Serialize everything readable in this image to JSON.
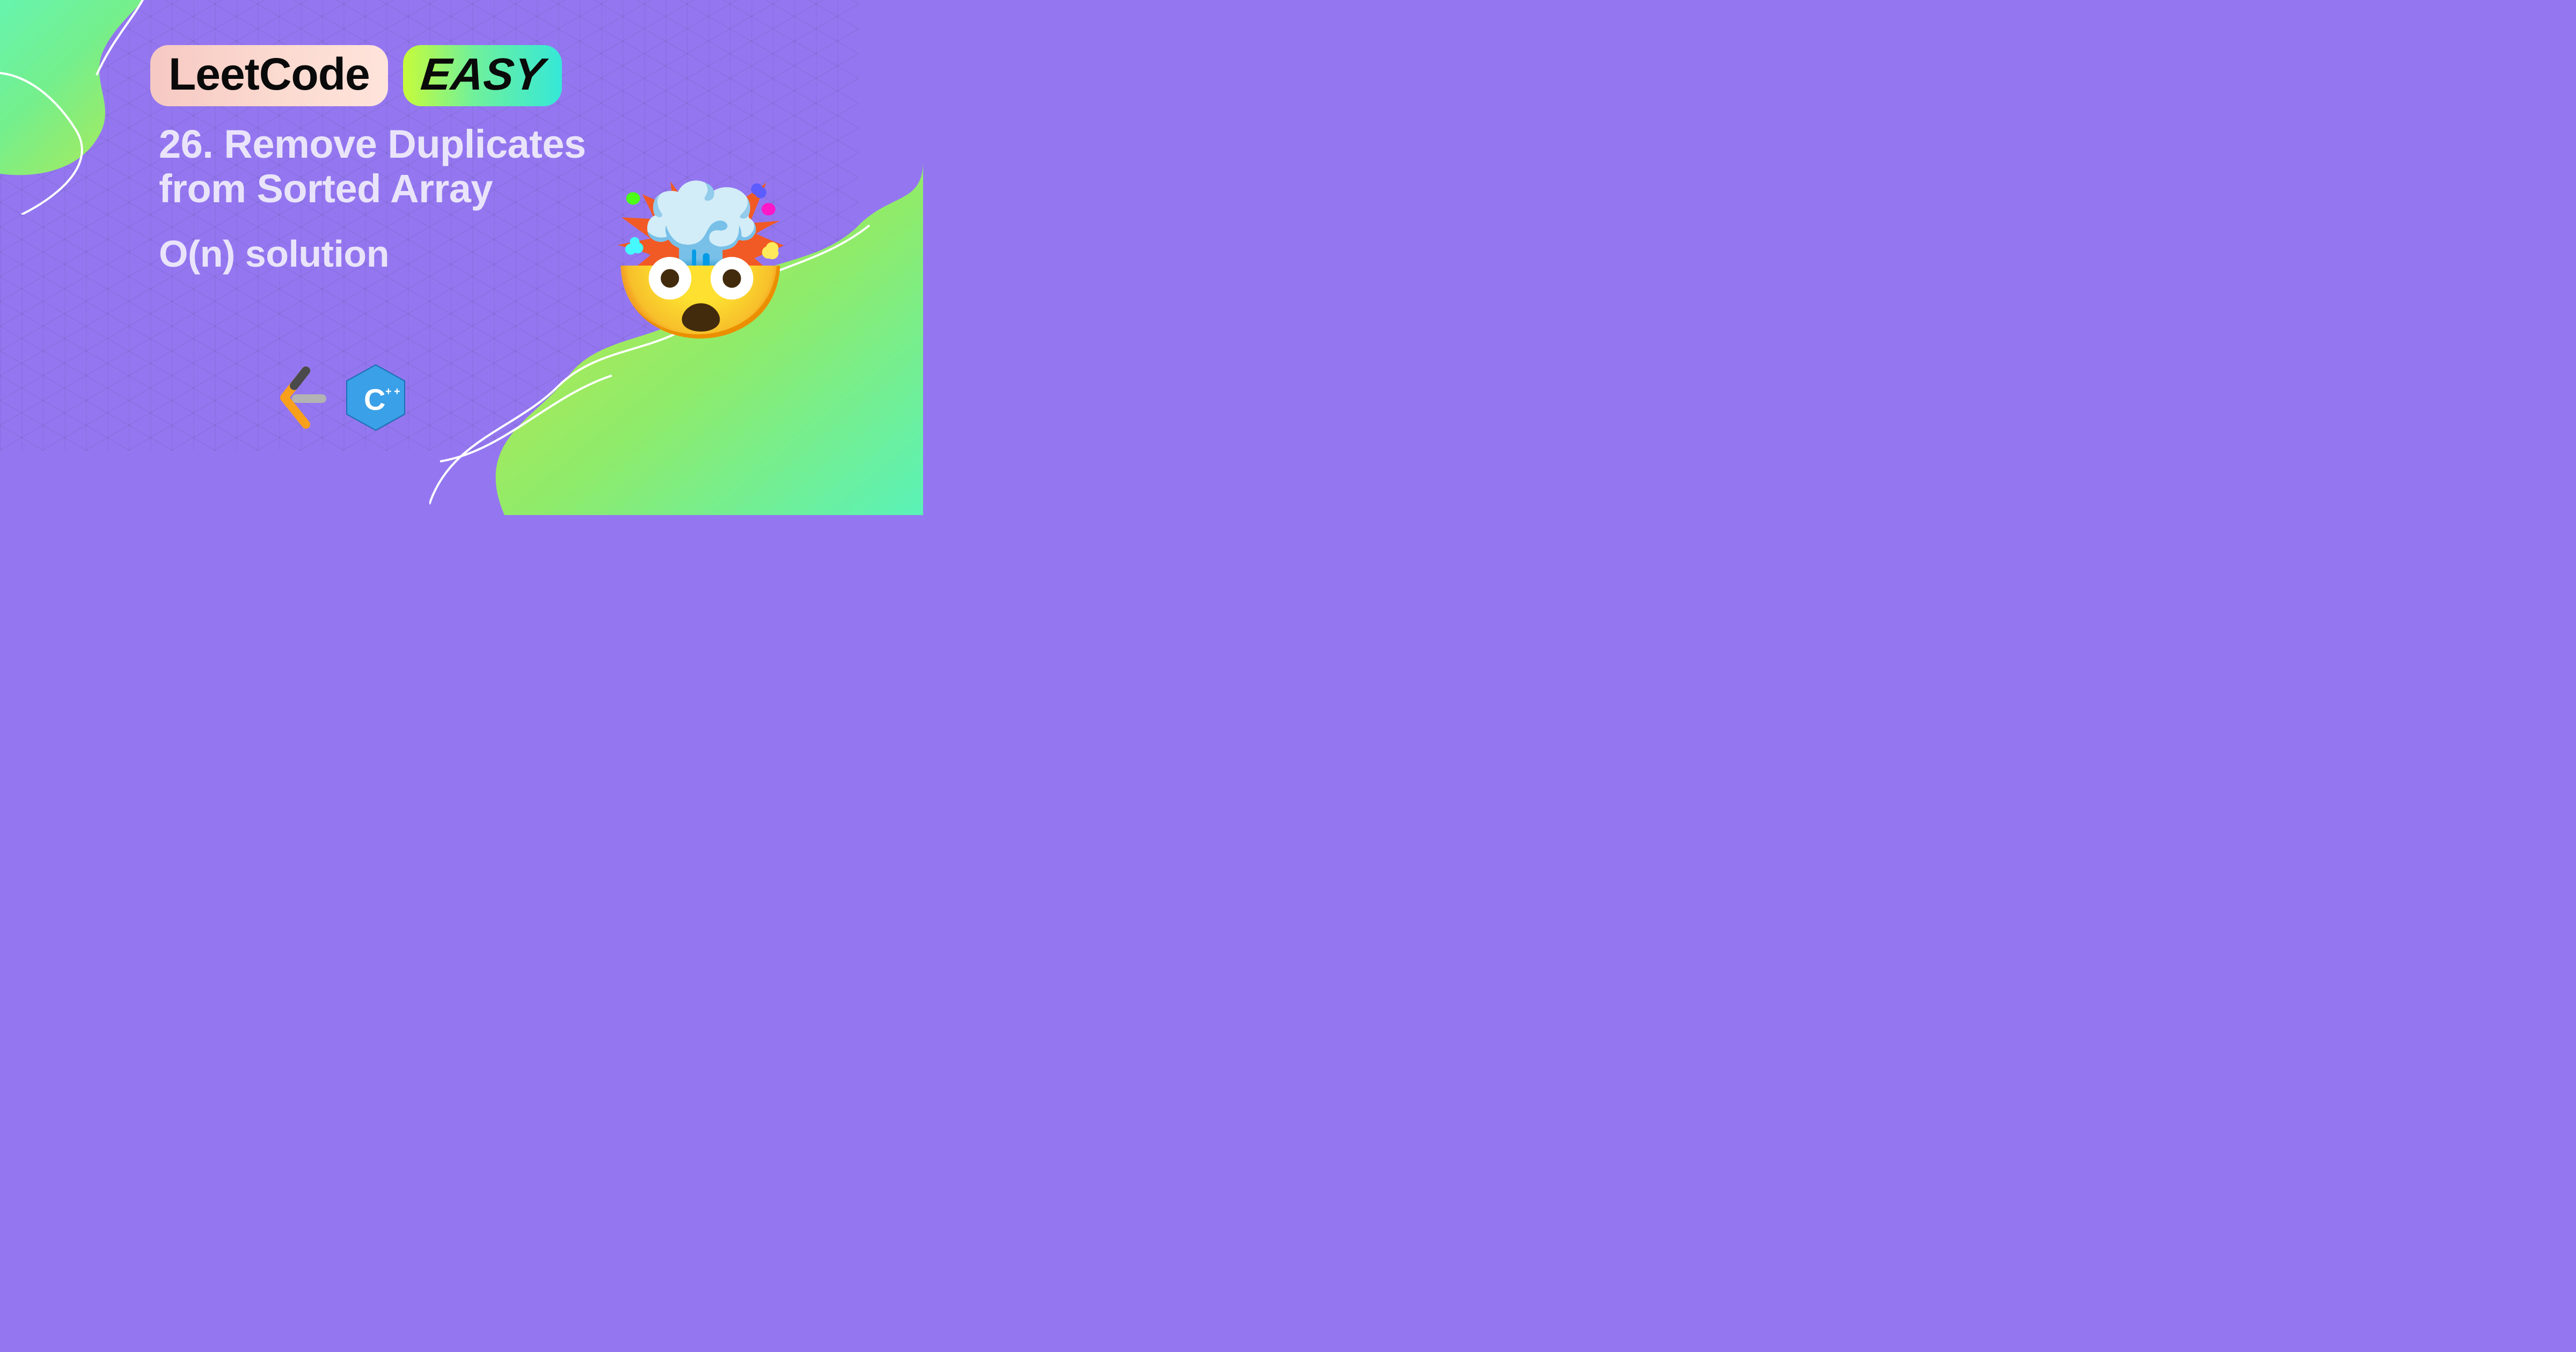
{
  "badges": {
    "leetcode": "LeetCode",
    "easy": "EASY"
  },
  "title": {
    "line1": "26. Remove Duplicates",
    "line2": "from Sorted Array"
  },
  "subtitle": "O(n) solution",
  "emoji": "🤯",
  "logos": {
    "leetcode": "leetcode-logo",
    "cpp": "cpp-logo"
  }
}
